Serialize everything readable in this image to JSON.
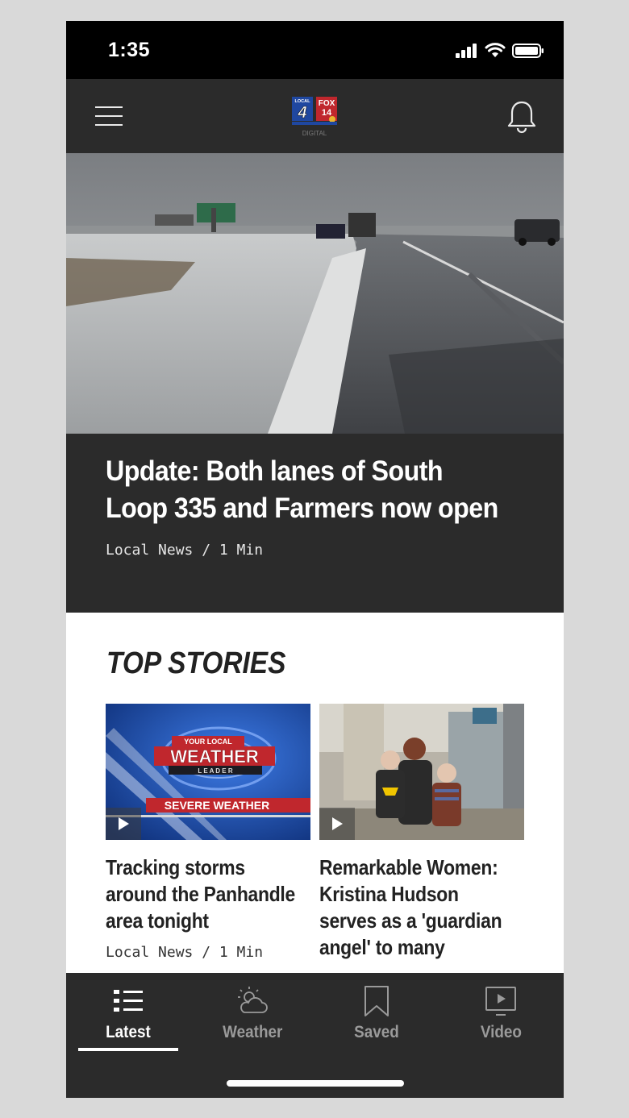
{
  "status_bar": {
    "time": "1:35"
  },
  "app_header": {
    "logo_text": {
      "local": "LOCAL",
      "four": "4",
      "fox": "FOX",
      "fourteen": "14",
      "digital": "DIGITAL"
    }
  },
  "hero": {
    "title": "Update: Both lanes of South Loop 335 and Farmers now open",
    "meta": "Local News / 1 Min"
  },
  "top_stories": {
    "heading": "TOP STORIES",
    "items": [
      {
        "title": "Tracking storms around the Panhandle area tonight",
        "meta": "Local News / 1 Min",
        "thumb_text": {
          "your_local": "YOUR LOCAL",
          "weather": "WEATHER",
          "leader": "L E A D E R",
          "severe": "SEVERE WEATHER"
        }
      },
      {
        "title": "Remarkable Women: Kristina Hudson serves as a 'guardian angel' to many",
        "meta": ""
      }
    ]
  },
  "tabbar": {
    "tabs": [
      {
        "label": "Latest",
        "icon": "list-icon",
        "active": true
      },
      {
        "label": "Weather",
        "icon": "weather-icon",
        "active": false
      },
      {
        "label": "Saved",
        "icon": "bookmark-icon",
        "active": false
      },
      {
        "label": "Video",
        "icon": "video-icon",
        "active": false
      }
    ]
  },
  "colors": {
    "bar_dark": "#2b2b2b",
    "accent_red": "#c0272d",
    "weather_blue": "#1b4aa8"
  }
}
